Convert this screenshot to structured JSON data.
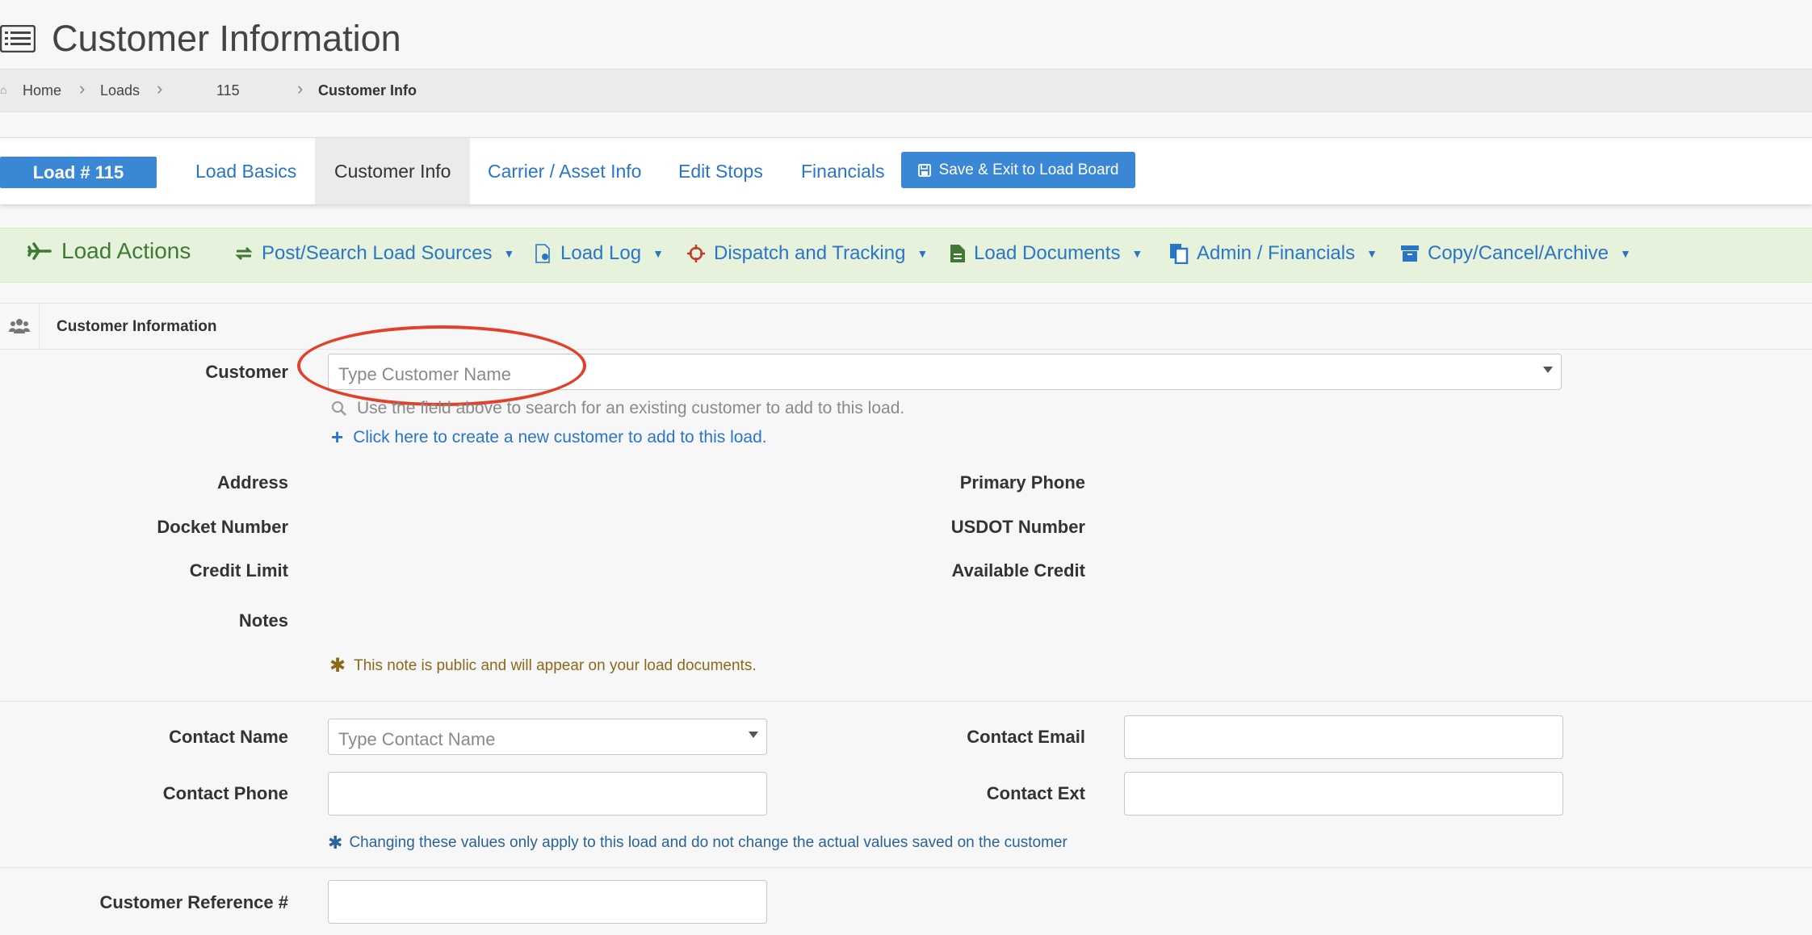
{
  "header": {
    "title": "Customer Information",
    "icon": "list-icon"
  },
  "breadcrumb": [
    {
      "label": "Home",
      "icon": "home-icon"
    },
    {
      "label": "Loads"
    },
    {
      "label": "115"
    },
    {
      "label": "Customer Info"
    }
  ],
  "tabs": {
    "load_badge": "Load # 115",
    "items": [
      {
        "label": "Load Basics"
      },
      {
        "label": "Customer Info"
      },
      {
        "label": "Carrier / Asset Info"
      },
      {
        "label": "Edit Stops"
      },
      {
        "label": "Financials"
      }
    ],
    "save_label": "Save & Exit to Load Board"
  },
  "actions": {
    "title": "Load Actions",
    "items": [
      {
        "label": "Post/Search Load Sources",
        "icon": "refresh-icon"
      },
      {
        "label": "Load Log",
        "icon": "document-search-icon"
      },
      {
        "label": "Dispatch and Tracking",
        "icon": "crosshair-icon"
      },
      {
        "label": "Load Documents",
        "icon": "file-icon"
      },
      {
        "label": "Admin / Financials",
        "icon": "copy-icon"
      },
      {
        "label": "Copy/Cancel/Archive",
        "icon": "archive-icon"
      }
    ]
  },
  "customer_panel": {
    "title": "Customer Information",
    "customer_label": "Customer",
    "customer_placeholder": "Type Customer Name",
    "search_help": "Use the field above to search for an existing customer to add to this load.",
    "create_link": "Click here to create a new customer to add to this load.",
    "fields": {
      "address": "Address",
      "primary_phone": "Primary Phone",
      "docket_number": "Docket Number",
      "usdot_number": "USDOT Number",
      "credit_limit": "Credit Limit",
      "available_credit": "Available Credit",
      "notes": "Notes"
    },
    "notes_warning": "This note is public and will appear on your load documents.",
    "contact": {
      "name_label": "Contact Name",
      "name_placeholder": "Type Contact Name",
      "email_label": "Contact Email",
      "email_value": "",
      "phone_label": "Contact Phone",
      "phone_value": "",
      "ext_label": "Contact Ext",
      "ext_value": "",
      "info_note": "Changing these values only apply to this load and do not change the actual values saved on the customer"
    },
    "reference_label": "Customer Reference #",
    "reference_value": ""
  },
  "colors": {
    "accent": "#3a87d6",
    "link": "#2a76c6",
    "actions_bg": "#e6f2db",
    "annotation": "#e2402a"
  }
}
